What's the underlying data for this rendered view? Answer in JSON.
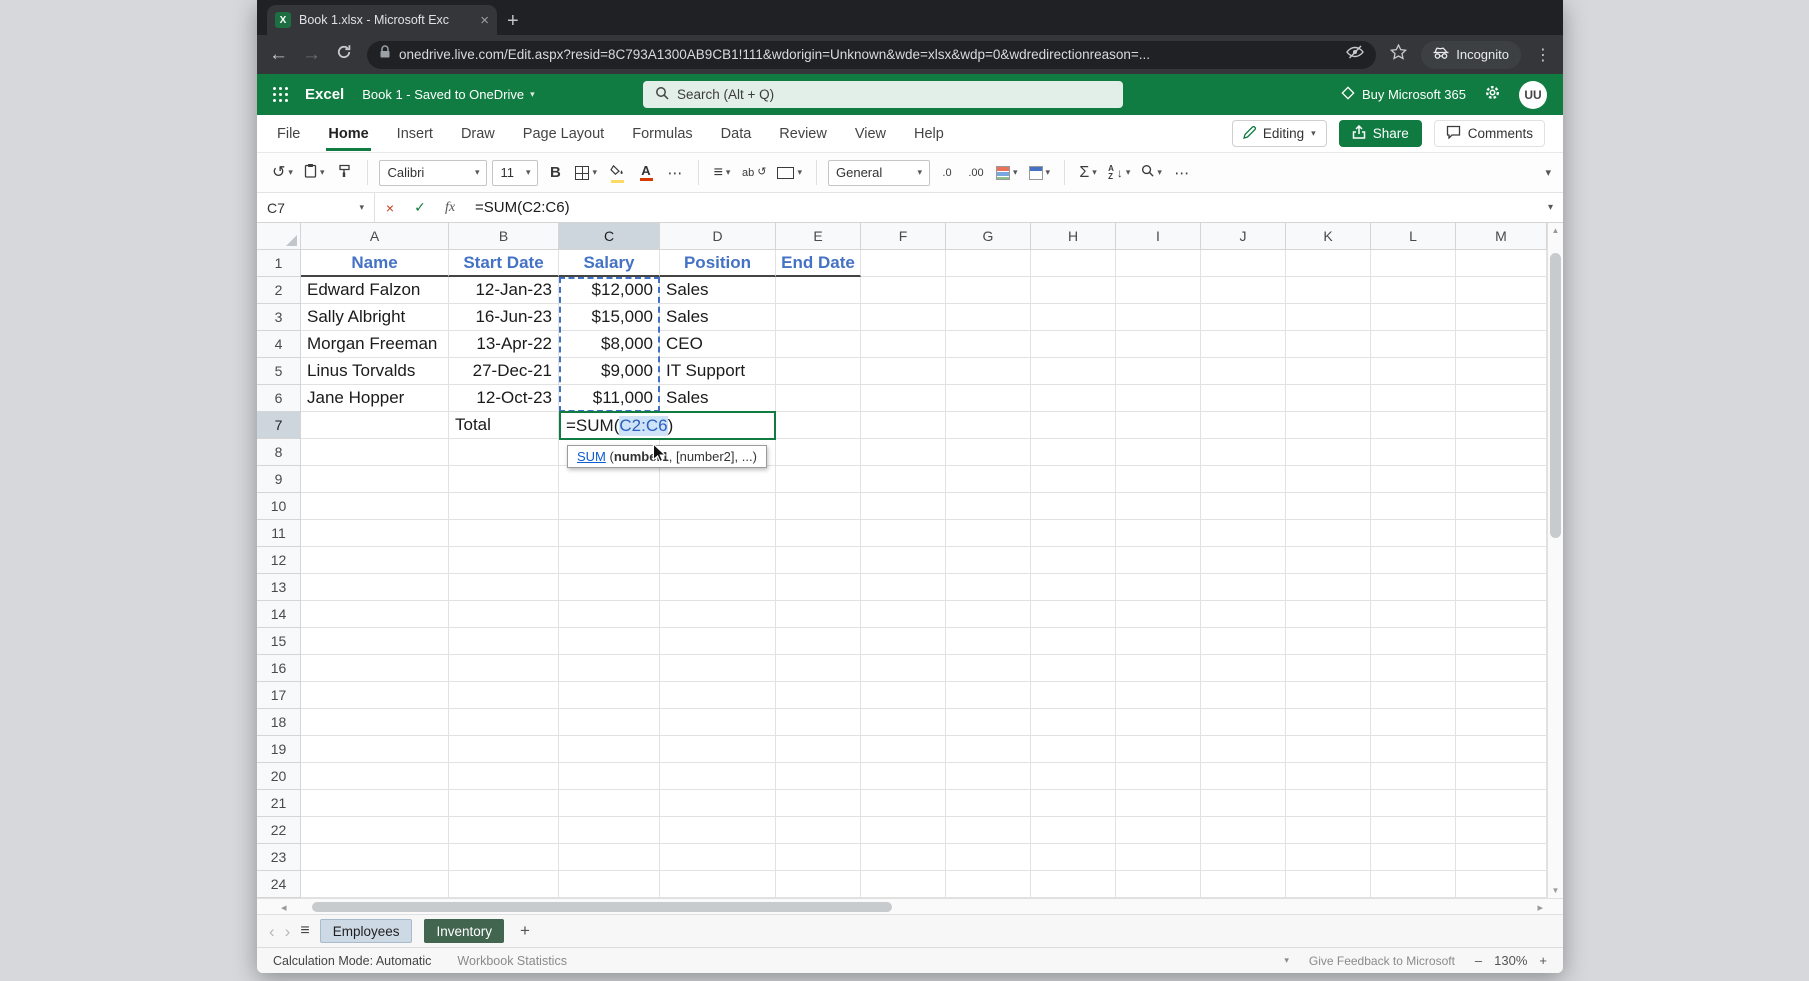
{
  "colors": {
    "excel_green": "#107C41",
    "share_green": "#0F7B41",
    "header_text_blue": "#4472C4",
    "range_ref_blue": "#4070C8",
    "browser_dark": "#202124",
    "browser_toolbar": "#35363A",
    "selected_header_bg": "#CDD6DD",
    "font_color_red": "#D83B01",
    "fill_color_yellow": "#FFD966"
  },
  "browser": {
    "tab_title": "Book 1.xlsx - Microsoft Exc",
    "new_tab": "+",
    "url": "onedrive.live.com/Edit.aspx?resid=8C793A1300AB9CB1!111&wdorigin=Unknown&wde=xlsx&wdp=0&wdredirectionreason=...",
    "incognito_label": "Incognito"
  },
  "app_header": {
    "app_name": "Excel",
    "doc_title": "Book 1 - Saved to OneDrive",
    "search_placeholder": "Search (Alt + Q)",
    "buy_label": "Buy Microsoft 365",
    "avatar_initials": "UU"
  },
  "ribbon": {
    "tabs": [
      "File",
      "Home",
      "Insert",
      "Draw",
      "Page Layout",
      "Formulas",
      "Data",
      "Review",
      "View",
      "Help"
    ],
    "active_tab": "Home",
    "editing_label": "Editing",
    "share_label": "Share",
    "comments_label": "Comments"
  },
  "toolbar": {
    "font_name": "Calibri",
    "font_size": "11",
    "bold_label": "B",
    "font_color_label": "A",
    "number_format": "General",
    "wrap_label": "ab",
    "dec_decrease": ".0",
    "dec_increase": ".00",
    "sort_a": "A",
    "sort_z": "Z"
  },
  "formula_bar": {
    "name_box": "C7",
    "fx_label": "fx",
    "formula": "=SUM(C2:C6)"
  },
  "grid": {
    "column_headers": [
      "A",
      "B",
      "C",
      "D",
      "E",
      "F",
      "G",
      "H",
      "I",
      "J",
      "K",
      "L",
      "M"
    ],
    "selected_column": "C",
    "row_count": 24,
    "selected_row": 7,
    "cells": [
      {
        "r": 1,
        "c": "A",
        "t": "Name",
        "cls": "hdr"
      },
      {
        "r": 1,
        "c": "B",
        "t": "Start Date",
        "cls": "hdr"
      },
      {
        "r": 1,
        "c": "C",
        "t": "Salary",
        "cls": "hdr"
      },
      {
        "r": 1,
        "c": "D",
        "t": "Position",
        "cls": "hdr"
      },
      {
        "r": 1,
        "c": "E",
        "t": "End Date",
        "cls": "hdr"
      },
      {
        "r": 2,
        "c": "A",
        "t": "Edward Falzon",
        "cls": "left"
      },
      {
        "r": 2,
        "c": "B",
        "t": "12-Jan-23",
        "cls": "right"
      },
      {
        "r": 2,
        "c": "C",
        "t": "$12,000",
        "cls": "right"
      },
      {
        "r": 2,
        "c": "D",
        "t": "Sales",
        "cls": "left"
      },
      {
        "r": 3,
        "c": "A",
        "t": "Sally Albright",
        "cls": "left"
      },
      {
        "r": 3,
        "c": "B",
        "t": "16-Jun-23",
        "cls": "right"
      },
      {
        "r": 3,
        "c": "C",
        "t": "$15,000",
        "cls": "right"
      },
      {
        "r": 3,
        "c": "D",
        "t": "Sales",
        "cls": "left"
      },
      {
        "r": 4,
        "c": "A",
        "t": "Morgan Freeman",
        "cls": "left"
      },
      {
        "r": 4,
        "c": "B",
        "t": "13-Apr-22",
        "cls": "right"
      },
      {
        "r": 4,
        "c": "C",
        "t": "$8,000",
        "cls": "right"
      },
      {
        "r": 4,
        "c": "D",
        "t": "CEO",
        "cls": "left"
      },
      {
        "r": 5,
        "c": "A",
        "t": "Linus Torvalds",
        "cls": "left"
      },
      {
        "r": 5,
        "c": "B",
        "t": "27-Dec-21",
        "cls": "right"
      },
      {
        "r": 5,
        "c": "C",
        "t": "$9,000",
        "cls": "right"
      },
      {
        "r": 5,
        "c": "D",
        "t": "IT Support",
        "cls": "left"
      },
      {
        "r": 6,
        "c": "A",
        "t": "Jane Hopper",
        "cls": "left"
      },
      {
        "r": 6,
        "c": "B",
        "t": "12-Oct-23",
        "cls": "right"
      },
      {
        "r": 6,
        "c": "C",
        "t": "$11,000",
        "cls": "right"
      },
      {
        "r": 6,
        "c": "D",
        "t": "Sales",
        "cls": "left"
      },
      {
        "r": 7,
        "c": "B",
        "t": "Total",
        "cls": "left"
      }
    ]
  },
  "edit_cell": {
    "prefix": "=SUM(",
    "range": "C2:C6",
    "suffix": ")"
  },
  "tooltip": {
    "fn": "SUM",
    "open": " (",
    "arg1": "number1",
    "rest": ", [number2], ...)"
  },
  "sheet_bar": {
    "tabs": [
      "Employees",
      "Inventory"
    ],
    "active_tab": "Employees",
    "add_label": "+"
  },
  "status_bar": {
    "calc_mode": "Calculation Mode: Automatic",
    "workbook_stats": "Workbook Statistics",
    "feedback": "Give Feedback to Microsoft",
    "zoom_out": "–",
    "zoom_level": "130%",
    "zoom_in": "+"
  },
  "icons": {
    "caret": "▾",
    "close": "×",
    "check": "✓",
    "back": "←",
    "forward": "→",
    "kebab": "⋮",
    "more": "⋯",
    "sigma": "Σ",
    "lines": "≡",
    "nav_left": "‹",
    "nav_right": "›",
    "undo": "↺",
    "arrow_down": "↓",
    "scroll_up": "▲",
    "scroll_down": "▼",
    "scroll_left": "◂",
    "scroll_right": "▸",
    "excel_logo": "X"
  }
}
